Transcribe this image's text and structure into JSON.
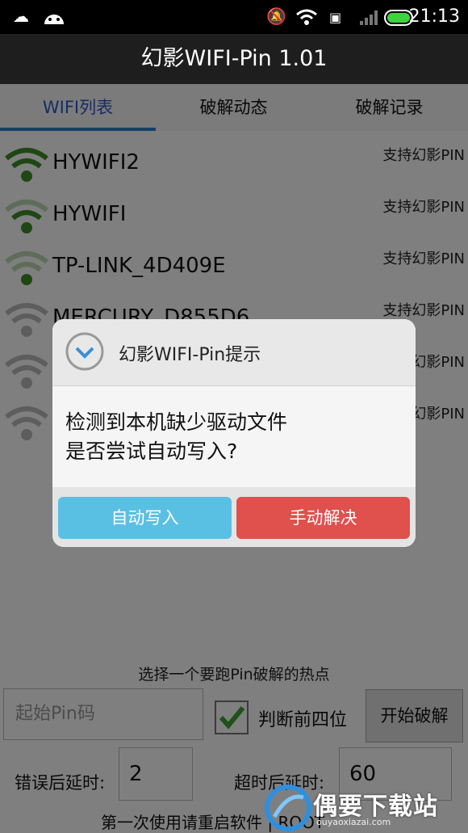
{
  "status_bar": {
    "time": "21:13",
    "icons": [
      "weather-icon",
      "android-icon",
      "mute-icon",
      "wifi-icon",
      "sim-icon",
      "signal-icon",
      "battery-icon"
    ]
  },
  "app": {
    "title": "幻影WIFI-Pin 1.01"
  },
  "tabs": [
    {
      "label": "WIFI列表",
      "active": true
    },
    {
      "label": "破解动态",
      "active": false
    },
    {
      "label": "破解记录",
      "active": false
    }
  ],
  "wifi_list": [
    {
      "ssid": "HYWIFI2",
      "support": "支持幻影PIN",
      "color": "#3f8e26"
    },
    {
      "ssid": "HYWIFI",
      "support": "支持幻影PIN",
      "color": "#3f8e26"
    },
    {
      "ssid": "TP-LINK_4D409E",
      "support": "支持幻影PIN",
      "color": "#3f8e26"
    },
    {
      "ssid": "MERCURY_D855D6",
      "support": "支持幻影PIN",
      "color": "#555555"
    },
    {
      "ssid": "",
      "support": "支持幻影PIN",
      "color": "#555555"
    },
    {
      "ssid": "",
      "support": "支持幻影PIN",
      "color": "#555555"
    }
  ],
  "bottom": {
    "hint": "选择一个要跑Pin破解的热点",
    "pin_placeholder": "起始Pin码",
    "check_label": "判断前四位",
    "checked": true,
    "start_button": "开始破解",
    "error_delay_label": "错误后延时:",
    "error_delay_value": "2",
    "timeout_delay_label": "超时后延时:",
    "timeout_delay_value": "60",
    "first_use_text": "第一次使用请重启软件 | ROOT"
  },
  "dialog": {
    "title": "幻影WIFI-Pin提示",
    "line1": "检测到本机缺少驱动文件",
    "line2": "是否尝试自动写入?",
    "auto_button": "自动写入",
    "manual_button": "手动解决"
  },
  "watermark": {
    "text": "偶要下载站",
    "sub": "ouyaoxiazai.com"
  }
}
